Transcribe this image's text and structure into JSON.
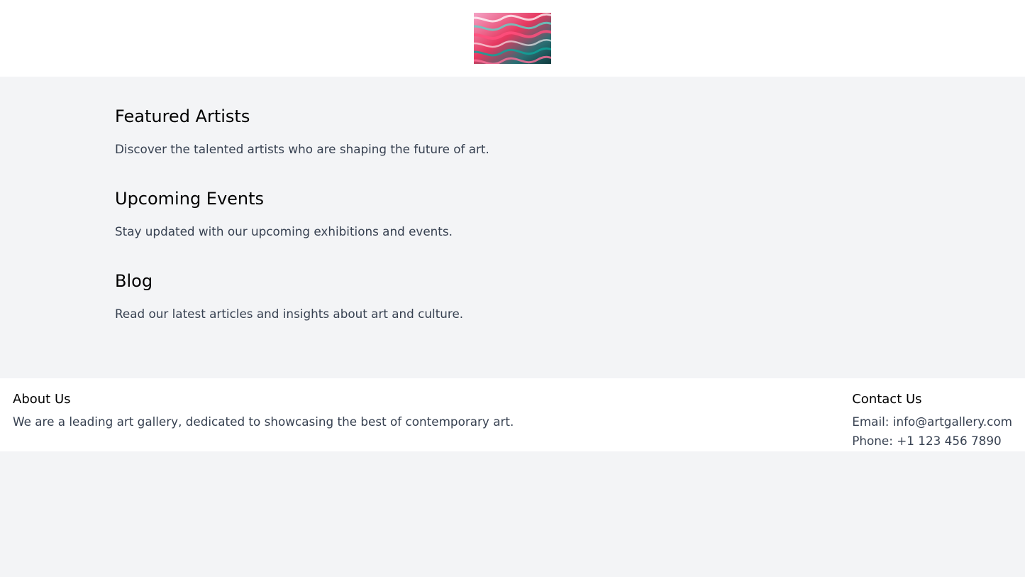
{
  "header": {
    "logo_alt": "logo-image"
  },
  "sections": [
    {
      "title": "Featured Artists",
      "text": "Discover the talented artists who are shaping the future of art."
    },
    {
      "title": "Upcoming Events",
      "text": "Stay updated with our upcoming exhibitions and events."
    },
    {
      "title": "Blog",
      "text": "Read our latest articles and insights about art and culture."
    }
  ],
  "footer": {
    "about": {
      "title": "About Us",
      "text": "We are a leading art gallery, dedicated to showcasing the best of contemporary art."
    },
    "contact": {
      "title": "Contact Us",
      "email": "Email: info@artgallery.com",
      "phone": "Phone: +1 123 456 7890"
    }
  },
  "colors": {
    "page_bg": "#f3f4f6",
    "surface": "#ffffff",
    "heading": "#000000",
    "body_text": "#374151"
  }
}
